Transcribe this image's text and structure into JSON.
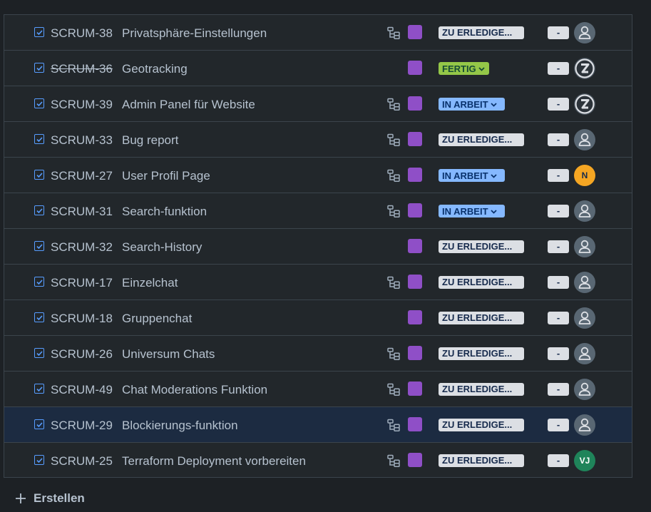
{
  "issues": [
    {
      "key": "SCRUM-38",
      "summary": "Privatsphäre-Einstellungen",
      "has_children": true,
      "status": "ZU ERLEDIGE...",
      "status_type": "todo",
      "estimate": "-",
      "assignee": {
        "type": "unassigned"
      }
    },
    {
      "key": "SCRUM-36",
      "summary": "Geotracking",
      "has_children": false,
      "done": true,
      "status": "FERTIG",
      "status_type": "done",
      "estimate": "-",
      "assignee": {
        "type": "image"
      }
    },
    {
      "key": "SCRUM-39",
      "summary": "Admin Panel für Website",
      "has_children": true,
      "status": "IN ARBEIT",
      "status_type": "prog",
      "estimate": "-",
      "assignee": {
        "type": "image"
      }
    },
    {
      "key": "SCRUM-33",
      "summary": "Bug report",
      "has_children": true,
      "status": "ZU ERLEDIGE...",
      "status_type": "todo",
      "estimate": "-",
      "assignee": {
        "type": "unassigned"
      }
    },
    {
      "key": "SCRUM-27",
      "summary": "User Profil Page",
      "has_children": true,
      "status": "IN ARBEIT",
      "status_type": "prog",
      "estimate": "-",
      "assignee": {
        "type": "initials",
        "initials": "N",
        "color": "#f5a623",
        "text_color": "#172b4d"
      }
    },
    {
      "key": "SCRUM-31",
      "summary": "Search-funktion",
      "has_children": true,
      "status": "IN ARBEIT",
      "status_type": "prog",
      "estimate": "-",
      "assignee": {
        "type": "unassigned"
      }
    },
    {
      "key": "SCRUM-32",
      "summary": "Search-History",
      "has_children": false,
      "status": "ZU ERLEDIGE...",
      "status_type": "todo",
      "estimate": "-",
      "assignee": {
        "type": "unassigned"
      }
    },
    {
      "key": "SCRUM-17",
      "summary": "Einzelchat",
      "has_children": true,
      "status": "ZU ERLEDIGE...",
      "status_type": "todo",
      "estimate": "-",
      "assignee": {
        "type": "unassigned"
      }
    },
    {
      "key": "SCRUM-18",
      "summary": "Gruppenchat",
      "has_children": false,
      "status": "ZU ERLEDIGE...",
      "status_type": "todo",
      "estimate": "-",
      "assignee": {
        "type": "unassigned"
      }
    },
    {
      "key": "SCRUM-26",
      "summary": "Universum Chats",
      "has_children": true,
      "status": "ZU ERLEDIGE...",
      "status_type": "todo",
      "estimate": "-",
      "assignee": {
        "type": "unassigned"
      }
    },
    {
      "key": "SCRUM-49",
      "summary": "Chat Moderations Funktion",
      "has_children": true,
      "status": "ZU ERLEDIGE...",
      "status_type": "todo",
      "estimate": "-",
      "assignee": {
        "type": "unassigned"
      }
    },
    {
      "key": "SCRUM-29",
      "summary": "Blockierungs-funktion",
      "has_children": true,
      "selected": true,
      "status": "ZU ERLEDIGE...",
      "status_type": "todo",
      "estimate": "-",
      "assignee": {
        "type": "unassigned"
      }
    },
    {
      "key": "SCRUM-25",
      "summary": "Terraform Deployment vorbereiten",
      "has_children": true,
      "status": "ZU ERLEDIGE...",
      "status_type": "todo",
      "estimate": "-",
      "assignee": {
        "type": "initials",
        "initials": "VJ",
        "color": "#1f845a",
        "text_color": "#ffffff"
      }
    }
  ],
  "epic_color": "#8f4fc7",
  "icons": {
    "issue_type": "checkbox-icon",
    "children": "child-issues-icon",
    "status_chevron": "chevron-down-icon",
    "unassigned": "person-icon",
    "create": "plus-icon"
  },
  "footer": {
    "create_label": "Erstellen"
  }
}
